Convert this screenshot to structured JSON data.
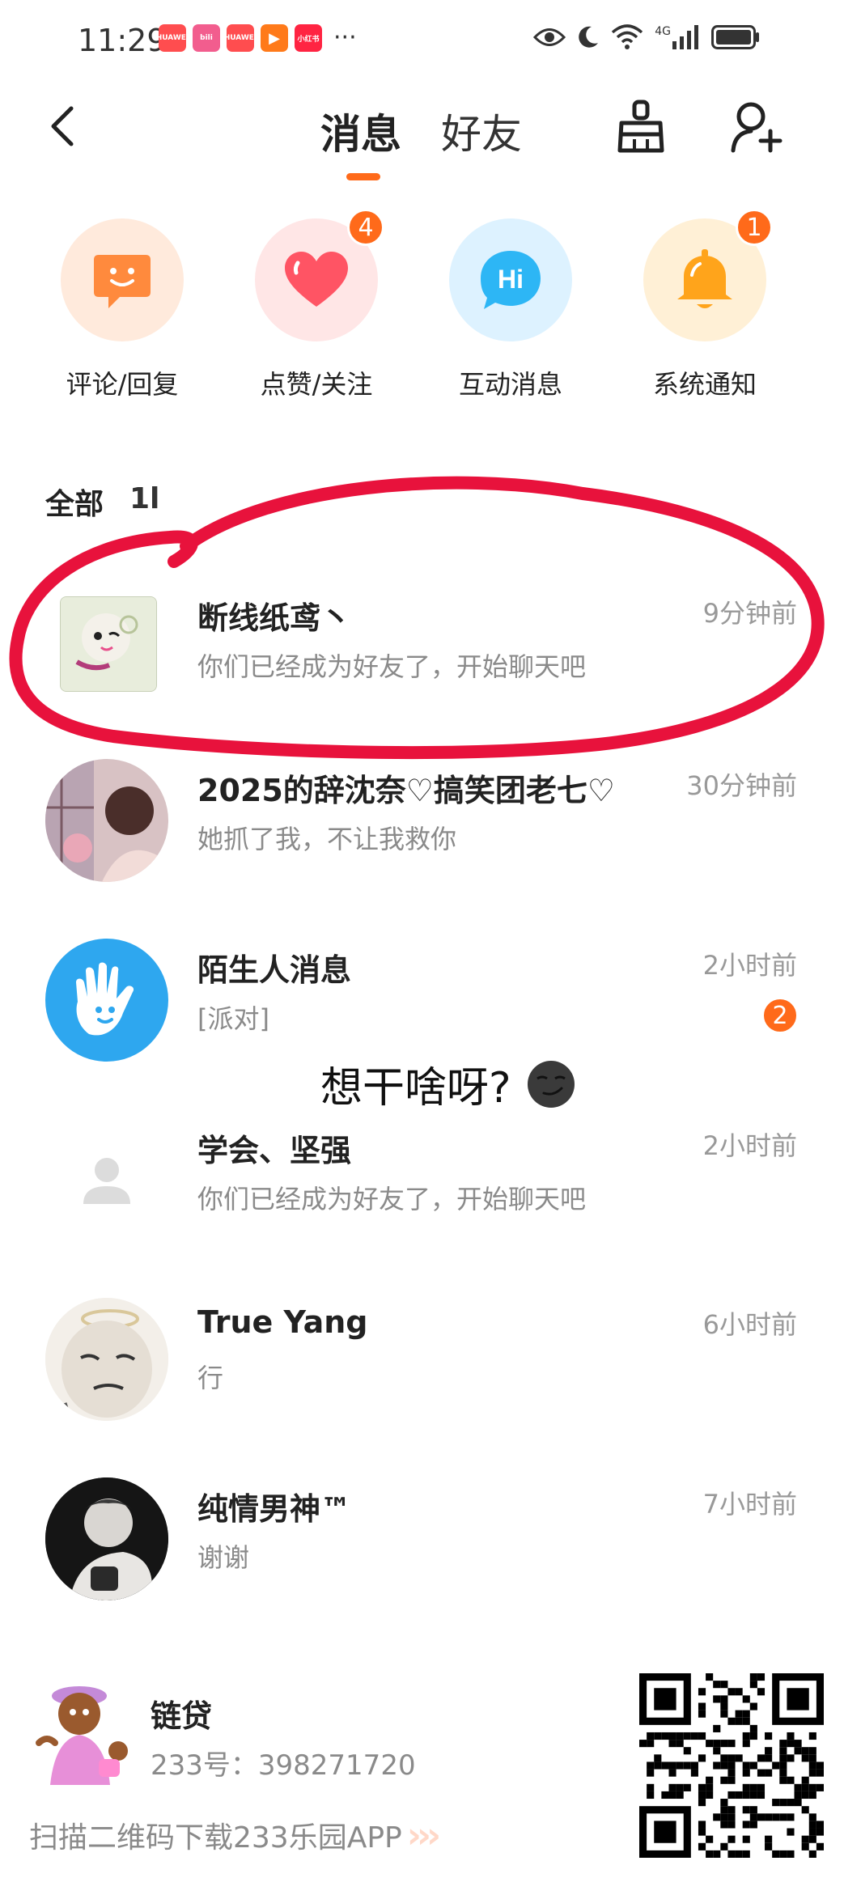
{
  "status_bar": {
    "time": "11:29",
    "notifications": [
      {
        "name": "huawei-notif",
        "color": "#ff4d4f",
        "text": "HUAWEI"
      },
      {
        "name": "bilibili-notif",
        "color": "#f25d8e",
        "text": "bili"
      },
      {
        "name": "huawei-notif-2",
        "color": "#ff4d4f",
        "text": "HUAWEI"
      },
      {
        "name": "video-notif",
        "color": "#ff7a1a",
        "text": "▶"
      },
      {
        "name": "xiaohongshu-notif",
        "color": "#ff2442",
        "text": "小红书"
      }
    ],
    "more": "···",
    "network_label": "4G"
  },
  "header": {
    "tab_messages": "消息",
    "tab_friends": "好友",
    "accent": "#ff6a1a"
  },
  "categories": [
    {
      "label": "评论/回复",
      "icon": "comment-smile-icon",
      "bg": "#ffeadc",
      "fg": "#ff8a3d",
      "badge": ""
    },
    {
      "label": "点赞/关注",
      "icon": "heart-icon",
      "bg": "#ffe6e6",
      "fg": "#ff5464",
      "badge": "4"
    },
    {
      "label": "互动消息",
      "icon": "hi-bubble-icon",
      "bg": "#ddf2ff",
      "fg": "#2db6f5",
      "badge": ""
    },
    {
      "label": "系统通知",
      "icon": "bell-icon",
      "bg": "#fff0d6",
      "fg": "#ffa41b",
      "badge": "1"
    }
  ],
  "list": {
    "section_title": "全部",
    "sort_label": "1l",
    "items": [
      {
        "name": "断线纸鸢丶",
        "message": "你们已经成为好友了，开始聊天吧",
        "time": "9分钟前",
        "badge": ""
      },
      {
        "name": "2025的辞沈奈♡搞笑团老七♡",
        "message": "她抓了我，不让我救你",
        "time": "30分钟前",
        "badge": ""
      },
      {
        "name": "陌生人消息",
        "message": "[派对]",
        "time": "2小时前",
        "badge": "2"
      },
      {
        "name": "学会、坚强",
        "message": "你们已经成为好友了，开始聊天吧",
        "time": "2小时前",
        "badge": ""
      },
      {
        "name": "True Yang",
        "message": "行",
        "time": "6小时前",
        "badge": ""
      },
      {
        "name": "纯情男神™",
        "message": "谢谢",
        "time": "7小时前",
        "badge": ""
      }
    ]
  },
  "overlay": {
    "text": "想干啥呀?"
  },
  "footer": {
    "name": "链贷",
    "id_line": "233号：398271720",
    "promo": "扫描二维码下载233乐园APP"
  },
  "annotation": {
    "color": "#e8123c"
  }
}
